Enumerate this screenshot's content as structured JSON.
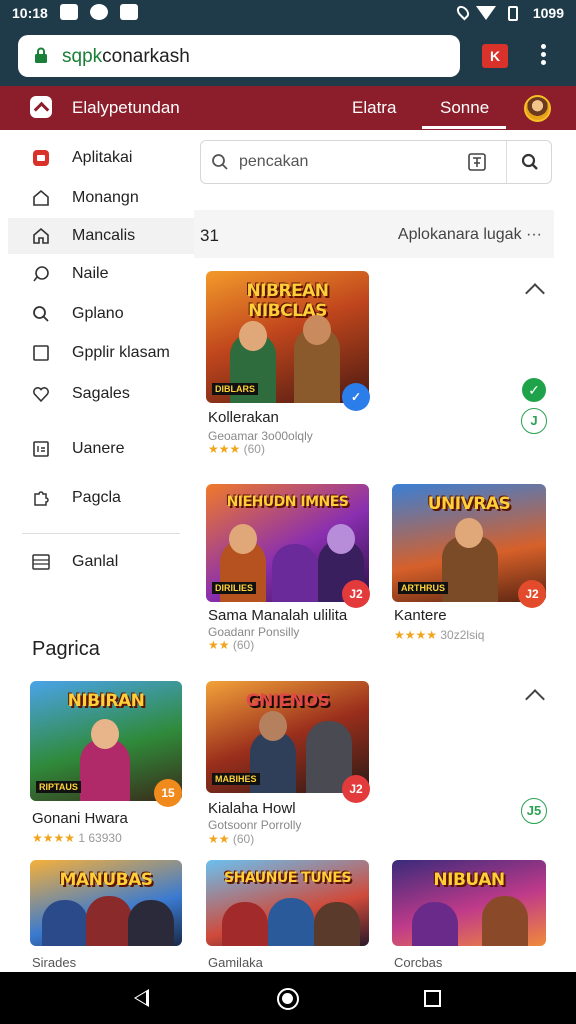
{
  "status_bar": {
    "time": "10:18",
    "battery_text": "1099"
  },
  "browser": {
    "url_domain": "sqpk",
    "url_rest": "conarkash",
    "tab_icon_label": "K"
  },
  "app_header": {
    "title": "Elalypetundan",
    "tab_1": "Elatra",
    "tab_2": "Sonne",
    "active_tab": "Sonne"
  },
  "sidebar": {
    "items": [
      {
        "label": "Aplitakai",
        "icon": "app-icon"
      },
      {
        "label": "Monangn",
        "icon": "home-icon"
      },
      {
        "label": "Mancalis",
        "icon": "house-icon"
      },
      {
        "label": "Naile",
        "icon": "chat-icon"
      },
      {
        "label": "Gplano",
        "icon": "search-icon"
      },
      {
        "label": "Gpplir klasam",
        "icon": "square-icon"
      },
      {
        "label": "Sagales",
        "icon": "heart-icon"
      },
      {
        "label": "Uanere",
        "icon": "grid-icon"
      },
      {
        "label": "Pagcla",
        "icon": "puzzle-icon"
      },
      {
        "label": "Ganlal",
        "icon": "list-icon"
      }
    ],
    "active_index": 2
  },
  "search": {
    "value": "pencakan"
  },
  "section1": {
    "number": "31",
    "right_label": "Aplokanara lugak ···"
  },
  "section2": {
    "title": "Pagrica"
  },
  "cards": [
    {
      "title_art": "NIBREAN NIBCLAS",
      "tag": "DIBLARS",
      "name": "Kollerakan",
      "meta": "Geoamar 3o00olqly",
      "stars": "★★★",
      "reviews": "(60)",
      "badge": "✓",
      "badge_color": "#2b7de9"
    },
    {
      "title_art": "NIEHUDN IMNES",
      "tag": "DIRILIES",
      "name": "Sama Manalah ulilita",
      "meta": "Goadanr Ponsilly",
      "stars": "★★",
      "reviews": "(60)",
      "badge": "J2",
      "badge_color": "#e33b3b"
    },
    {
      "title_art": "UNIVRAS",
      "tag": "ARTHRUS",
      "name": "Kantere",
      "meta": "",
      "stars": "★★★★",
      "reviews": "30z2lsiq",
      "badge": "J2",
      "badge_color": "#e24c2c"
    },
    {
      "title_art": "NIBIRAN",
      "tag": "RIPTAUS",
      "name": "Gonani Hwara",
      "meta": "",
      "stars": "★★★★",
      "reviews": "1 63930",
      "badge": "15",
      "badge_color": "#f08a1c"
    },
    {
      "title_art": "GNIENOS",
      "tag": "MABIHES",
      "name": "Kialaha Howl",
      "meta": "Gotsoonr Porrolly",
      "stars": "★★",
      "reviews": "(60)",
      "badge": "J2",
      "badge_color": "#e33b3b"
    },
    {
      "title_art": "MANUBAS",
      "tag": "",
      "name": "Sirades",
      "meta": "",
      "stars": "",
      "reviews": "",
      "badge": "",
      "badge_color": "#e33b3b"
    },
    {
      "title_art": "SHAUNUE TUNES",
      "tag": "",
      "name": "Gamilaka",
      "meta": "",
      "stars": "",
      "reviews": "",
      "badge": "",
      "badge_color": "#e33b3b"
    },
    {
      "title_art": "NIBUAN",
      "tag": "",
      "name": "Corcbas",
      "meta": "",
      "stars": "",
      "reviews": "",
      "badge": "",
      "badge_color": "#e33b3b"
    }
  ],
  "side_marks": {
    "ring_1": "J",
    "ring_2": "J5"
  },
  "colors": {
    "header": "#8b1e2a",
    "statusbar": "#1f3b4a",
    "accent_green": "#1fa34a"
  }
}
